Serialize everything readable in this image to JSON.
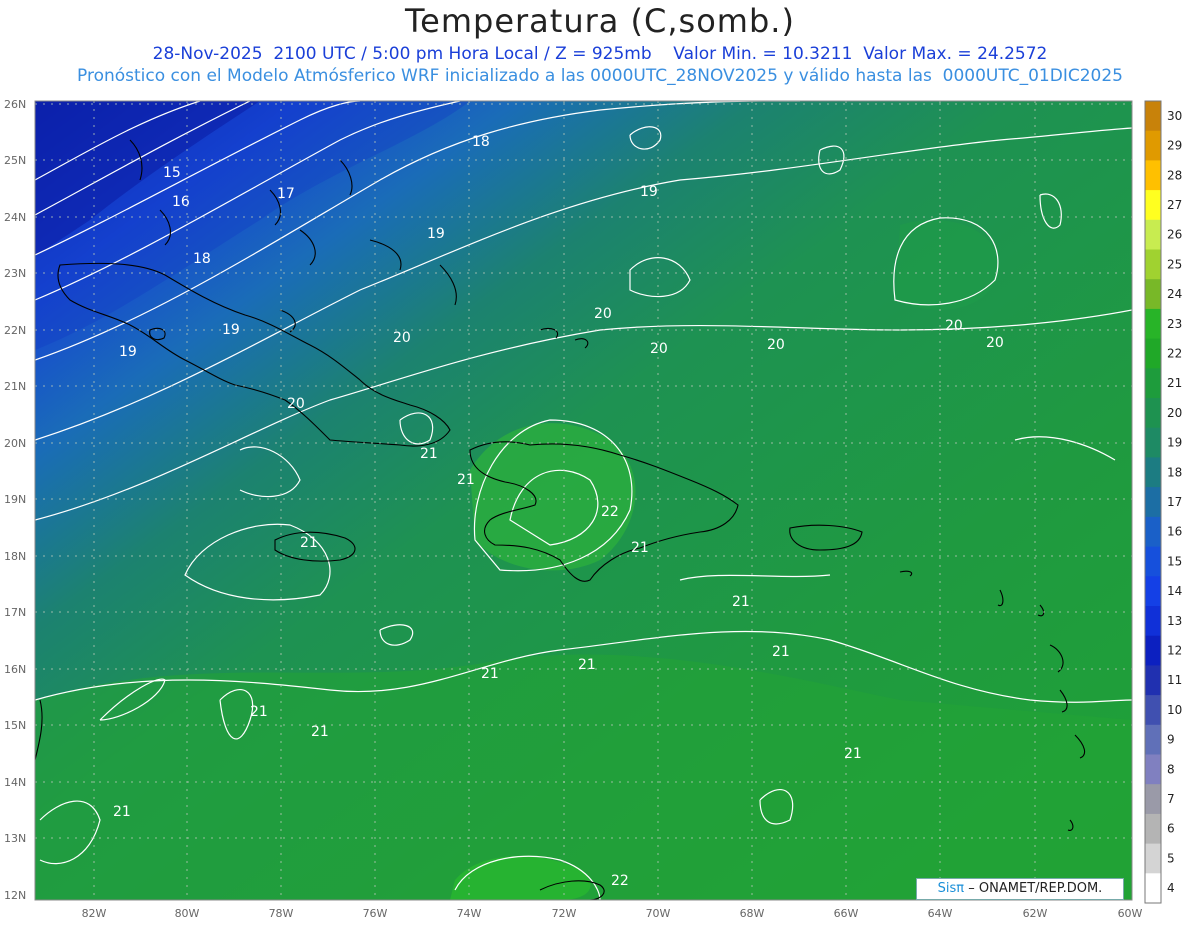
{
  "header": {
    "title": "Temperatura (C,somb.)",
    "subtitle_line1": "28-Nov-2025  2100 UTC / 5:00 pm Hora Local / Z = 925mb    Valor Min. = 10.3211  Valor Max. = 24.2572",
    "subtitle_line2": "Pronóstico con el Modelo Atmósferico WRF inicializado a las 0000UTC_28NOV2025 y válido hasta las  0000UTC_01DIC2025"
  },
  "map": {
    "lat_labels": [
      "26N",
      "25N",
      "24N",
      "23N",
      "22N",
      "21N",
      "20N",
      "19N",
      "18N",
      "17N",
      "16N",
      "15N",
      "14N",
      "13N",
      "12N"
    ],
    "lon_labels": [
      "82W",
      "80W",
      "78W",
      "76W",
      "74W",
      "72W",
      "70W",
      "68W",
      "66W",
      "64W",
      "62W",
      "60W"
    ],
    "contour_labels": [
      "15",
      "16",
      "17",
      "18",
      "18",
      "19",
      "19",
      "19",
      "19",
      "20",
      "20",
      "20",
      "20",
      "20",
      "20",
      "20",
      "21",
      "21",
      "21",
      "21",
      "21",
      "21",
      "21",
      "21",
      "21",
      "21",
      "21",
      "21",
      "22",
      "22"
    ]
  },
  "colorbar": {
    "levels": [
      "30",
      "29",
      "28",
      "27",
      "26",
      "25",
      "24",
      "23",
      "22",
      "21",
      "20",
      "19",
      "18",
      "17",
      "16",
      "15",
      "14",
      "13",
      "12",
      "11",
      "10",
      "9",
      "8",
      "7",
      "6",
      "5",
      "4"
    ],
    "colors": [
      "#c8820a",
      "#e09a00",
      "#ffc000",
      "#ffff20",
      "#c8ec50",
      "#a0d230",
      "#78b828",
      "#28b428",
      "#20a828",
      "#1e9c3c",
      "#1e9250",
      "#1e8a64",
      "#1c7c82",
      "#1c6ea4",
      "#1a60c8",
      "#1650dc",
      "#1440e6",
      "#1030d8",
      "#0c20c0",
      "#2030b0",
      "#4050b0",
      "#6070b8",
      "#8080c0",
      "#9a9aa8",
      "#b4b4b4",
      "#d4d4d4",
      "#ffffff"
    ]
  },
  "credit": {
    "brand": "Sisπ",
    "text": "– ONAMET/REP.DOM."
  }
}
